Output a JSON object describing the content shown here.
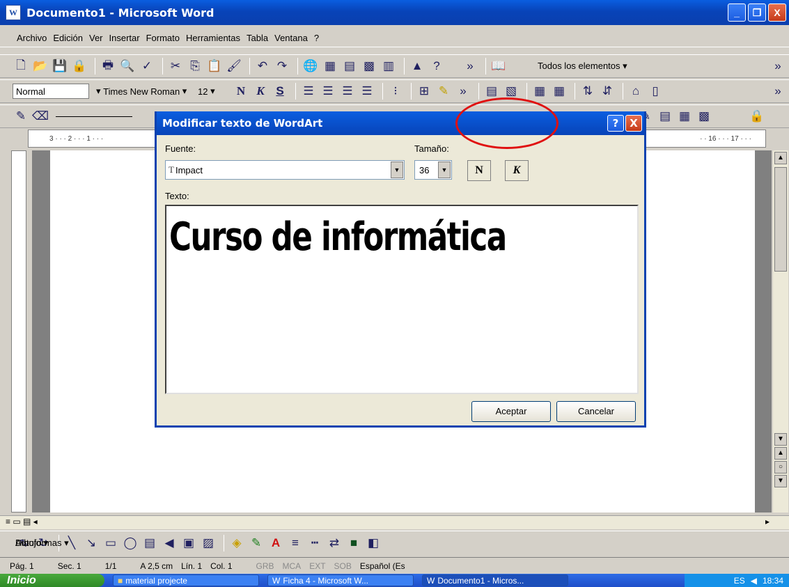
{
  "window": {
    "title": "Documento1 - Microsoft Word",
    "minimize": "_",
    "restore": "❐",
    "close": "X"
  },
  "menu": [
    "Archivo",
    "Edición",
    "Ver",
    "Insertar",
    "Formato",
    "Herramientas",
    "Tabla",
    "Ventana",
    "?"
  ],
  "toolbar1": {
    "task_pane_label": "Todos los elementos ▾"
  },
  "toolbar2": {
    "style": "Normal",
    "font": "Times New Roman",
    "size": "12",
    "bold": "N",
    "italic": "K",
    "underline": "S"
  },
  "ruler": {
    "text": "3 · · · 2 · · · 1 · · ·",
    "right_text": "· · 16 · · · 17 · · ·"
  },
  "dialog": {
    "title": "Modificar texto de WordArt",
    "help": "?",
    "close": "X",
    "font_label": "Fuente:",
    "size_label": "Tamaño:",
    "font_value": "Impact",
    "size_value": "36",
    "bold": "N",
    "italic": "K",
    "text_label": "Texto:",
    "text_value": "Curso de informática",
    "ok": "Aceptar",
    "cancel": "Cancelar"
  },
  "drawbar": {
    "draw": "Dibujo ▾",
    "autoshapes": "Autoformas ▾"
  },
  "status": {
    "page": "Pág. 1",
    "sec": "Sec. 1",
    "pages": "1/1",
    "pos": "A 2,5 cm",
    "line": "Lín. 1",
    "col": "Col. 1",
    "grb": "GRB",
    "mca": "MCA",
    "ext": "EXT",
    "sob": "SOB",
    "lang": "Español (Es"
  },
  "taskbar": {
    "start": "Inicio",
    "items": [
      "material projecte",
      "Ficha 4 - Microsoft W...",
      "Documento1 - Micros..."
    ],
    "lang": "ES",
    "time": "18:34"
  },
  "colors": {
    "title_blue": "#0843b8",
    "highlight_red": "#e01010"
  }
}
